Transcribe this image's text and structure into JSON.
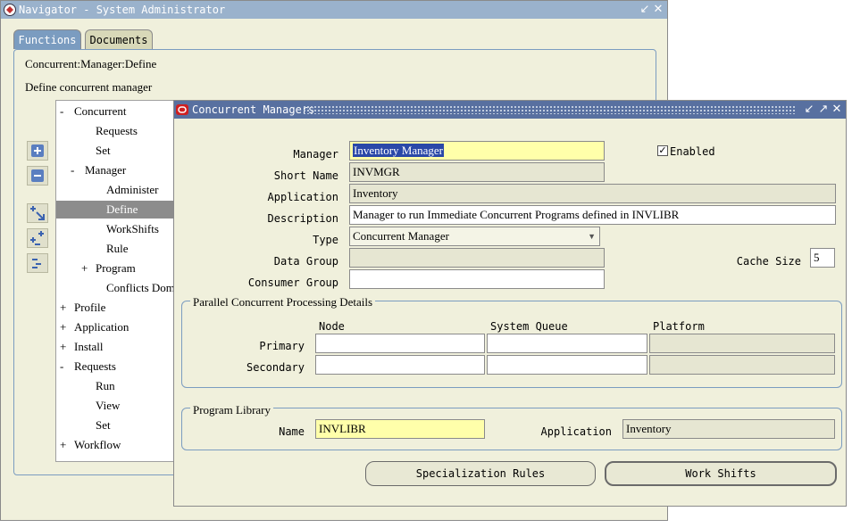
{
  "navigator": {
    "title": "Navigator - System Administrator",
    "tabs": [
      "Functions",
      "Documents"
    ],
    "function_name": "Concurrent:Manager:Define",
    "function_desc": "Define concurrent manager",
    "tree": [
      {
        "prefix": "-",
        "label": "Concurrent"
      },
      {
        "prefix": "",
        "label": "Requests"
      },
      {
        "prefix": "",
        "label": "Set"
      },
      {
        "prefix": "-",
        "label": "Manager"
      },
      {
        "prefix": "",
        "label": "Administer"
      },
      {
        "prefix": "",
        "label": "Define"
      },
      {
        "prefix": "",
        "label": "WorkShifts"
      },
      {
        "prefix": "",
        "label": "Rule"
      },
      {
        "prefix": "+",
        "label": "Program"
      },
      {
        "prefix": "",
        "label": "Conflicts Domains"
      },
      {
        "prefix": "+",
        "label": "Profile"
      },
      {
        "prefix": "+",
        "label": "Application"
      },
      {
        "prefix": "+",
        "label": "Install"
      },
      {
        "prefix": "-",
        "label": "Requests"
      },
      {
        "prefix": "",
        "label": "Run"
      },
      {
        "prefix": "",
        "label": "View"
      },
      {
        "prefix": "",
        "label": "Set"
      },
      {
        "prefix": "+",
        "label": "Workflow"
      }
    ],
    "tools": [
      "expand-icon",
      "collapse-icon",
      "expand-branch-icon",
      "expand-all-icon",
      "collapse-all-icon"
    ]
  },
  "cm": {
    "title": "Concurrent Managers",
    "labels": {
      "manager": "Manager",
      "short_name": "Short Name",
      "application": "Application",
      "description": "Description",
      "type": "Type",
      "data_group": "Data Group",
      "consumer_group": "Consumer Group",
      "enabled": "Enabled",
      "cache_size": "Cache Size"
    },
    "values": {
      "manager": "Inventory Manager",
      "short_name": "INVMGR",
      "application": "Inventory",
      "description": "Manager to run Immediate Concurrent Programs defined in INVLIBR",
      "type": "Concurrent Manager",
      "data_group": "",
      "consumer_group": "",
      "enabled": true,
      "cache_size": "5"
    },
    "parallel": {
      "title": "Parallel Concurrent Processing Details",
      "col_node": "Node",
      "col_queue": "System Queue",
      "col_platform": "Platform",
      "row_primary": "Primary",
      "row_secondary": "Secondary"
    },
    "library": {
      "title": "Program Library",
      "name_label": "Name",
      "name_value": "INVLIBR",
      "app_label": "Application",
      "app_value": "Inventory"
    },
    "buttons": {
      "specialization": "Specialization Rules",
      "work_shifts": "Work Shifts"
    }
  },
  "colors": {
    "title_bar": "#9ab2cc",
    "window_bg": "#f0f0dc",
    "required_field": "#ffffaa",
    "selection": "#2a48a8",
    "tree_selected": "#8c8c8c"
  }
}
